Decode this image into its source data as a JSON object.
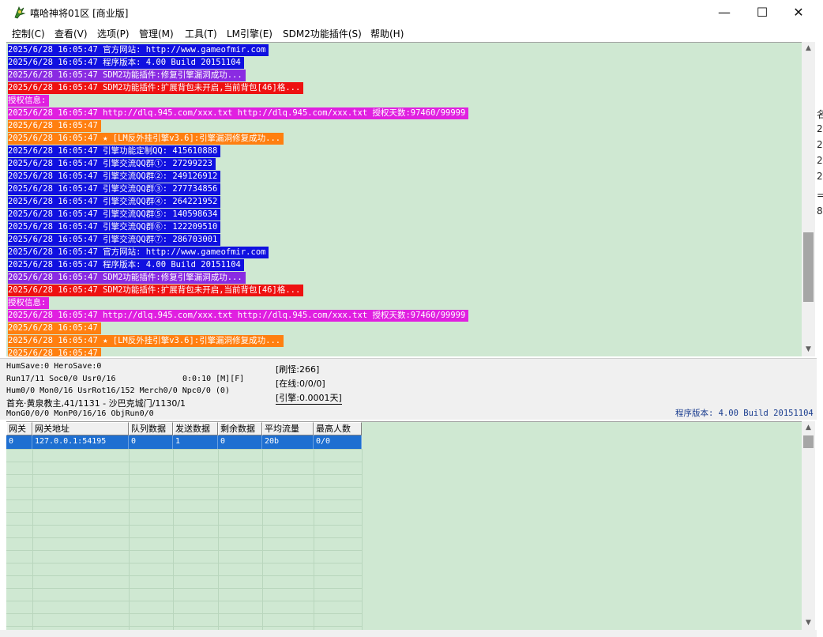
{
  "window": {
    "title": "嘻哈神将01区 [商业版]",
    "min_glyph": "—",
    "max_glyph": "☐",
    "close_glyph": "✕",
    "icon": "app-logo-icon"
  },
  "menu": [
    {
      "label": "控制(C)"
    },
    {
      "label": "查看(V)"
    },
    {
      "label": "选项(P)"
    },
    {
      "label": "管理(M)"
    },
    {
      "label": "工具(T)"
    },
    {
      "label": "LM引擎(E)"
    },
    {
      "label": "SDM2功能插件(S)"
    },
    {
      "label": "帮助(H)"
    }
  ],
  "colors": {
    "blue": "#1010e0",
    "purple": "#8a2be2",
    "red": "#ee1111",
    "magenta": "#e020e0",
    "orange": "#ff7f10",
    "pane_bg": "#cfe8d2",
    "row_selected": "#1e6fd1"
  },
  "log": [
    {
      "text": "2025/6/28 16:05:47 官方网站: http://www.gameofmir.com",
      "color": "blue"
    },
    {
      "text": "2025/6/28 16:05:47 程序版本: 4.00 Build 20151104",
      "color": "blue"
    },
    {
      "text": "2025/6/28 16:05:47 SDM2功能插件:修复引擎漏洞成功...",
      "color": "purple"
    },
    {
      "text": "2025/6/28 16:05:47 SDM2功能插件:扩展背包未开启,当前背包[46]格...",
      "color": "red"
    },
    {
      "text": "授权信息:",
      "color": "magenta"
    },
    {
      "text": "2025/6/28 16:05:47 http://dlq.945.com/xxx.txt http://dlq.945.com/xxx.txt 授权天数:97460/99999",
      "color": "magenta"
    },
    {
      "text": "2025/6/28 16:05:47",
      "color": "orange"
    },
    {
      "text": "2025/6/28 16:05:47 ★ [LM反外挂引擎v3.6]:引擎漏洞修复成功...",
      "color": "orange"
    },
    {
      "text": "2025/6/28 16:05:47 引擎功能定制QQ: 415610888",
      "color": "blue"
    },
    {
      "text": "2025/6/28 16:05:47 引擎交流QQ群①: 27299223",
      "color": "blue"
    },
    {
      "text": "2025/6/28 16:05:47 引擎交流QQ群②: 249126912",
      "color": "blue"
    },
    {
      "text": "2025/6/28 16:05:47 引擎交流QQ群③: 277734856",
      "color": "blue"
    },
    {
      "text": "2025/6/28 16:05:47 引擎交流QQ群④: 264221952",
      "color": "blue"
    },
    {
      "text": "2025/6/28 16:05:47 引擎交流QQ群⑤: 140598634",
      "color": "blue"
    },
    {
      "text": "2025/6/28 16:05:47 引擎交流QQ群⑥: 122209510",
      "color": "blue"
    },
    {
      "text": "2025/6/28 16:05:47 引擎交流QQ群⑦: 286703001",
      "color": "blue"
    },
    {
      "text": "2025/6/28 16:05:47 官方网站: http://www.gameofmir.com",
      "color": "blue"
    },
    {
      "text": "2025/6/28 16:05:47 程序版本: 4.00 Build 20151104",
      "color": "blue"
    },
    {
      "text": "2025/6/28 16:05:47 SDM2功能插件:修复引擎漏洞成功...",
      "color": "purple"
    },
    {
      "text": "2025/6/28 16:05:47 SDM2功能插件:扩展背包未开启,当前背包[46]格...",
      "color": "red"
    },
    {
      "text": "授权信息:",
      "color": "magenta"
    },
    {
      "text": "2025/6/28 16:05:47 http://dlq.945.com/xxx.txt http://dlq.945.com/xxx.txt 授权天数:97460/99999",
      "color": "magenta"
    },
    {
      "text": "2025/6/28 16:05:47",
      "color": "orange"
    },
    {
      "text": "2025/6/28 16:05:47 ★ [LM反外挂引擎v3.6]:引擎漏洞修复成功...",
      "color": "orange"
    },
    {
      "text": "2025/6/28 16:05:47",
      "color": "orange"
    }
  ],
  "status": {
    "humsave": "HumSave:0 HeroSave:0",
    "run": "Run17/11 Soc0/0 Usr0/16",
    "timer": "0:0:10 [M][F]",
    "hum": "Hum0/0 Mon0/16 UsrRot16/152 Merch0/0 Npc0/0 (0)",
    "map": "首充·黄泉教主,41/1131 - 沙巴克城门/1130/1",
    "mong": "MonG0/0/0 MonP0/16/16 ObjRun0/0",
    "refresh": "[刷怪:266]",
    "online": "[在线:0/0/0]",
    "engine": "[引擎:0.0001天]",
    "version": "程序版本: 4.00 Build 20151104"
  },
  "gateway_grid": {
    "columns": [
      "网关",
      "网关地址",
      "队列数据",
      "发送数据",
      "剩余数据",
      "平均流量",
      "最高人数"
    ],
    "rows": [
      [
        "0",
        "127.0.0.1:54195",
        "0",
        "1",
        "0",
        "20b",
        "0/0"
      ]
    ]
  },
  "sidepeek": [
    "名",
    "2",
    "2",
    "2",
    "2",
    "=",
    "8"
  ]
}
